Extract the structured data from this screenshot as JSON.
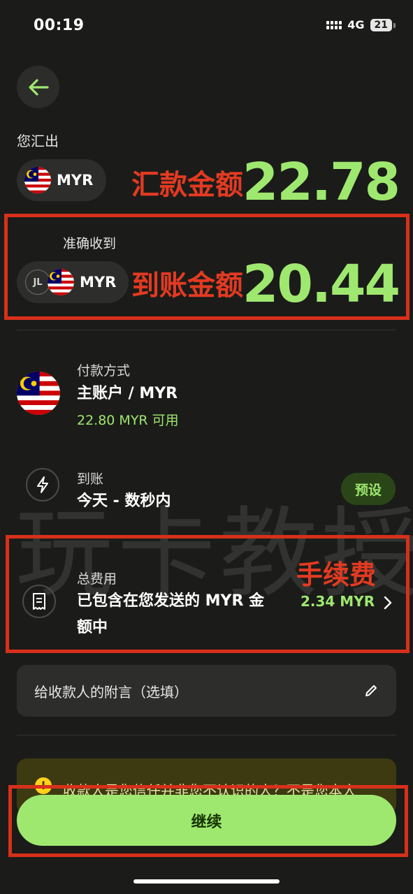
{
  "status_bar": {
    "time": "00:19",
    "network": "4G",
    "battery": "21"
  },
  "send": {
    "label": "您汇出",
    "currency": "MYR",
    "amount": "22.78",
    "annotation": "汇款金额"
  },
  "receive": {
    "label": "准确收到",
    "recipient_initials": "JL",
    "currency": "MYR",
    "amount": "20.44",
    "annotation": "到账金额"
  },
  "payment_method": {
    "title": "付款方式",
    "account": "主账户 / MYR",
    "available": "22.80 MYR 可用"
  },
  "arrival": {
    "title": "到账",
    "value": "今天 - 数秒内",
    "badge": "预设"
  },
  "fees": {
    "title": "总费用",
    "description_line1": "已包含在您发送的 MYR 金",
    "description_line2": "额中",
    "amount": "2.34 MYR",
    "annotation": "手续费"
  },
  "watermark": "玩卡教授",
  "note": {
    "placeholder": "给收款人的附言（选填）"
  },
  "warning": {
    "text": "收款人是您信任并非您不认识的人？不是您本人"
  },
  "continue_button": {
    "label": "继续"
  },
  "icons": {
    "back": "arrow-left-icon",
    "flag": "malaysia-flag-icon",
    "arrival": "lightning-icon",
    "fees": "receipt-icon",
    "chevron": "chevron-right-icon",
    "edit": "pencil-icon",
    "warning": "warning-icon"
  },
  "colors": {
    "accent": "#9fe870",
    "background": "#1b1c19",
    "annotation_red": "#d8301b"
  }
}
